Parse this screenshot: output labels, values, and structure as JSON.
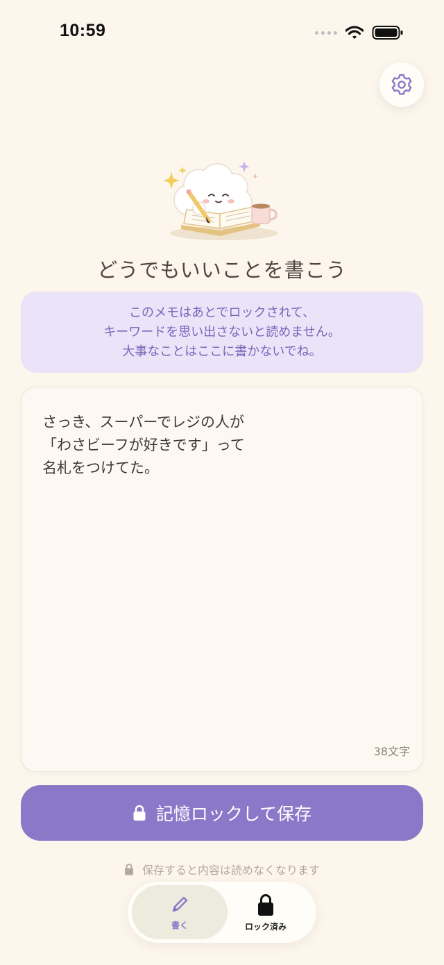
{
  "status_bar": {
    "time": "10:59"
  },
  "settings": {
    "icon": "gear-icon"
  },
  "heading": "どうでもいいことを書こう",
  "notice": {
    "lines": [
      "このメモはあとでロックされて、",
      "キーワードを思い出さないと読めません。",
      "大事なことはここに書かないでね。"
    ]
  },
  "memo": {
    "lines": [
      "さっき、スーパーでレジの人が",
      "「わさビーフが好きです」って",
      "名札をつけてた。"
    ],
    "char_count": "38文字"
  },
  "save_button": {
    "label": "記憶ロックして保存",
    "icon": "lock-icon"
  },
  "footnote": {
    "text": "保存すると内容は読めなくなります",
    "icon": "lock-icon"
  },
  "tabs": [
    {
      "label": "書く",
      "icon": "pencil-icon",
      "active": true
    },
    {
      "label": "ロック済み",
      "icon": "lock-icon",
      "active": false
    }
  ],
  "colors": {
    "background": "#fcf6ec",
    "accent": "#8b78c8",
    "notice_bg": "#ebe4f9",
    "notice_text": "#7a64b8"
  }
}
